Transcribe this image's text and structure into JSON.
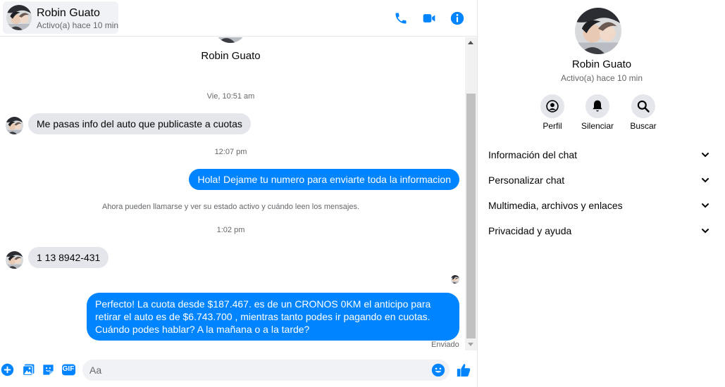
{
  "contact": {
    "name": "Robin Guato",
    "status": "Activo(a) hace 10 min"
  },
  "header": {
    "icons": [
      "phone-icon",
      "video-camera-icon",
      "info-icon"
    ]
  },
  "conversation": {
    "top_name": "Robin Guato",
    "messages": [
      {
        "kind": "timestamp",
        "text": "Vie, 10:51 am"
      },
      {
        "kind": "incoming",
        "text": "Me pasas info del auto que publicaste a cuotas"
      },
      {
        "kind": "timestamp",
        "text": "12:07 pm"
      },
      {
        "kind": "outgoing",
        "text": "Hola! Dejame tu numero  para enviarte toda la informacion"
      },
      {
        "kind": "system",
        "text": "Ahora pueden llamarse y ver su estado activo y cuándo leen los mensajes."
      },
      {
        "kind": "timestamp",
        "text": "1:02 pm"
      },
      {
        "kind": "incoming",
        "text": "1 13 8942-431"
      },
      {
        "kind": "outgoing",
        "text": "Perfecto! La cuota desde $187.467. es de un CRONOS 0KM el anticipo para retirar el auto es de $6.743.700 , mientras tanto podes ir pagando en cuotas. Cuándo podes hablar? A la mañana o a la tarde?"
      }
    ],
    "sent_label": "Enviado"
  },
  "composer": {
    "placeholder": "Aa",
    "value": "",
    "icons": [
      "plus-circle-icon",
      "gallery-icon",
      "sticker-icon",
      "gif-icon",
      "emoji-icon",
      "thumbs-up-icon"
    ],
    "gif_label": "GIF"
  },
  "info_panel": {
    "name": "Robin Guato",
    "status": "Activo(a) hace 10 min",
    "actions": [
      {
        "icon": "profile-icon",
        "label": "Perfil"
      },
      {
        "icon": "bell-icon",
        "label": "Silenciar"
      },
      {
        "icon": "search-icon",
        "label": "Buscar"
      }
    ],
    "sections": [
      "Información del chat",
      "Personalizar chat",
      "Multimedia, archivos y enlaces",
      "Privacidad y ayuda"
    ]
  },
  "colors": {
    "accent": "#0084ff",
    "incoming_bubble": "#e4e6eb",
    "secondary_text": "#65676b"
  }
}
